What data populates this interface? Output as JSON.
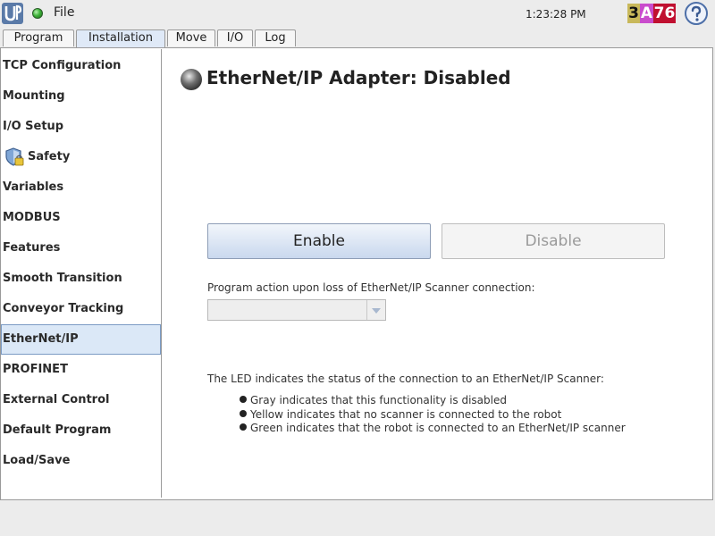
{
  "topbar": {
    "file_label": "File",
    "clock": "1:23:28 PM",
    "speed_badge": [
      "3",
      "A",
      "76"
    ],
    "status_led_color": "#3fb33a"
  },
  "tabs": [
    {
      "label": "Program",
      "active": false
    },
    {
      "label": "Installation",
      "active": true
    },
    {
      "label": "Move",
      "active": false
    },
    {
      "label": "I/O",
      "active": false
    },
    {
      "label": "Log",
      "active": false
    }
  ],
  "sidebar": {
    "items": [
      {
        "label": "TCP Configuration"
      },
      {
        "label": "Mounting"
      },
      {
        "label": "I/O Setup"
      },
      {
        "label": "Safety",
        "icon": "safety-shield-icon"
      },
      {
        "label": "Variables"
      },
      {
        "label": "MODBUS"
      },
      {
        "label": "Features"
      },
      {
        "label": "Smooth Transition"
      },
      {
        "label": "Conveyor Tracking"
      },
      {
        "label": "EtherNet/IP",
        "selected": true
      },
      {
        "label": "PROFINET"
      },
      {
        "label": "External Control"
      },
      {
        "label": "Default Program"
      },
      {
        "label": "Load/Save"
      }
    ]
  },
  "main": {
    "title": "EtherNet/IP Adapter: Disabled",
    "led_state": "gray",
    "enable_label": "Enable",
    "disable_label": "Disable",
    "loss_action_label": "Program action upon loss of EtherNet/IP Scanner connection:",
    "loss_action_value": "",
    "led_info": "The LED indicates the status of the connection to an EtherNet/IP Scanner:",
    "bullets": [
      "Gray indicates that this functionality is disabled",
      "Yellow indicates that no scanner is connected to the robot",
      "Green indicates that the robot is connected to an EtherNet/IP scanner"
    ]
  }
}
